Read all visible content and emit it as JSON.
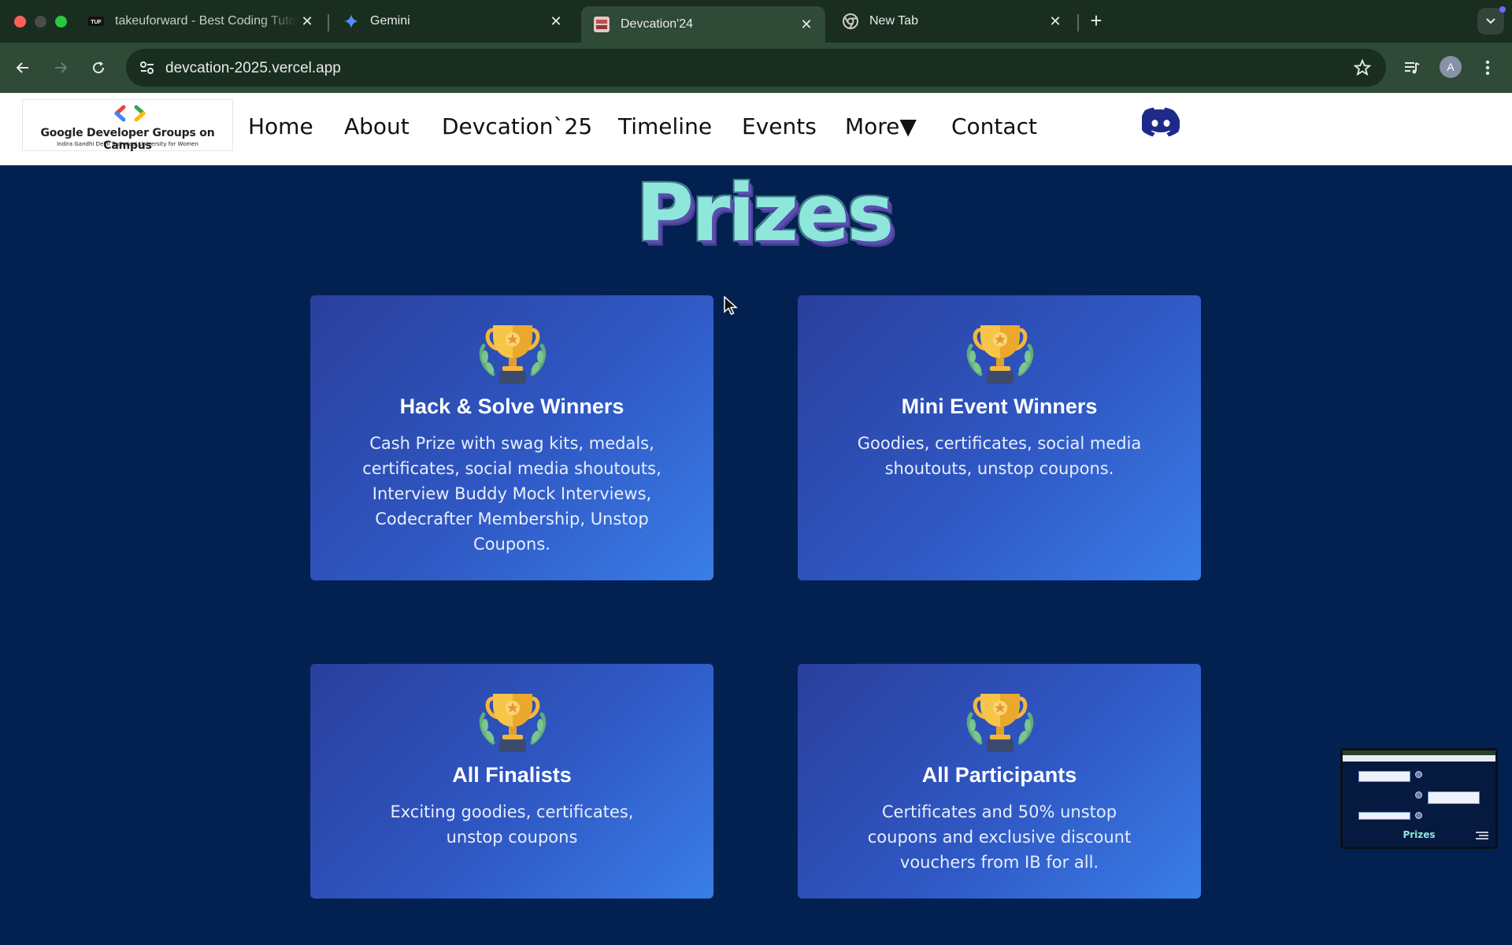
{
  "browser": {
    "tabs": [
      {
        "title": "takeuforward - Best Coding Tutorials",
        "favicon": "tuf-icon"
      },
      {
        "title": "Gemini",
        "favicon": "gemini-icon"
      },
      {
        "title": "Devcation'24",
        "favicon": "devcation-icon",
        "active": true
      },
      {
        "title": "New Tab",
        "favicon": "chrome-icon"
      }
    ],
    "url": "devcation-2025.vercel.app",
    "profile_initial": "A"
  },
  "site": {
    "logo": {
      "line1": "Google Developer Groups on Campus",
      "line2": "Indira Gandhi Delhi Technical University for Women"
    },
    "nav": [
      "Home",
      "About",
      "Devcation`25",
      "Timeline",
      "Events",
      "More▼",
      "Contact"
    ]
  },
  "main": {
    "section_title": "Prizes",
    "cards": [
      {
        "title": "Hack & Solve Winners",
        "description": "Cash Prize with swag kits, medals, certificates, social media shoutouts, Interview Buddy Mock Interviews, Codecrafter Membership, Unstop Coupons.",
        "icon": "trophy-icon"
      },
      {
        "title": "Mini Event Winners",
        "description": "Goodies, certificates, social media shoutouts, unstop coupons.",
        "icon": "trophy-icon"
      },
      {
        "title": "All Finalists",
        "description": "Exciting goodies, certificates, unstop coupons",
        "icon": "trophy-icon"
      },
      {
        "title": "All Participants",
        "description": "Certificates and 50% unstop coupons and exclusive discount vouchers from IB for all.",
        "icon": "trophy-icon"
      }
    ]
  },
  "preview_thumbnail": {
    "title": "Prizes"
  },
  "colors": {
    "page_bg": "#022150",
    "card_gradient_start": "#2a3f9c",
    "card_gradient_end": "#3a7ee8",
    "title_teal": "#8fe7dc",
    "discord_blue": "#1e2a8a"
  }
}
